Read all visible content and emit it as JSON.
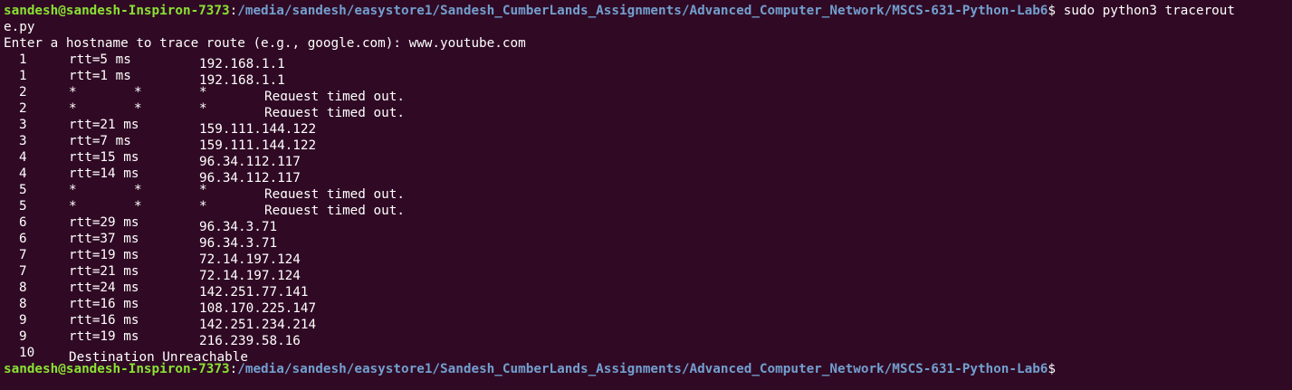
{
  "prompt": {
    "user_host": "sandesh@sandesh-Inspiron-7373",
    "path": "/media/sandesh/easystore1/Sandesh_CumberLands_Assignments/Advanced_Computer_Network/MSCS-631-Python-Lab6",
    "symbol": "$"
  },
  "command": {
    "first_line": " sudo python3 tracerout",
    "wrap_line": "e.py"
  },
  "input_prompt": "Enter a hostname to trace route (e.g., google.com): www.youtube.com",
  "rows": [
    {
      "hop": "1",
      "type": "ok",
      "rtt": "rtt=5 ms",
      "ip": "192.168.1.1"
    },
    {
      "hop": "1",
      "type": "ok",
      "rtt": "rtt=1 ms",
      "ip": "192.168.1.1"
    },
    {
      "hop": "2",
      "type": "timeout",
      "s1": "*",
      "s2": "*",
      "s3": "*",
      "msg": "Request timed out."
    },
    {
      "hop": "2",
      "type": "timeout",
      "s1": "*",
      "s2": "*",
      "s3": "*",
      "msg": "Request timed out."
    },
    {
      "hop": "3",
      "type": "ok",
      "rtt": "rtt=21 ms",
      "ip": "159.111.144.122"
    },
    {
      "hop": "3",
      "type": "ok",
      "rtt": "rtt=7 ms",
      "ip": "159.111.144.122"
    },
    {
      "hop": "4",
      "type": "ok",
      "rtt": "rtt=15 ms",
      "ip": "96.34.112.117"
    },
    {
      "hop": "4",
      "type": "ok",
      "rtt": "rtt=14 ms",
      "ip": "96.34.112.117"
    },
    {
      "hop": "5",
      "type": "timeout",
      "s1": "*",
      "s2": "*",
      "s3": "*",
      "msg": "Request timed out."
    },
    {
      "hop": "5",
      "type": "timeout",
      "s1": "*",
      "s2": "*",
      "s3": "*",
      "msg": "Request timed out."
    },
    {
      "hop": "6",
      "type": "ok",
      "rtt": "rtt=29 ms",
      "ip": "96.34.3.71"
    },
    {
      "hop": "6",
      "type": "ok",
      "rtt": "rtt=37 ms",
      "ip": "96.34.3.71"
    },
    {
      "hop": "7",
      "type": "ok",
      "rtt": "rtt=19 ms",
      "ip": "72.14.197.124"
    },
    {
      "hop": "7",
      "type": "ok",
      "rtt": "rtt=21 ms",
      "ip": "72.14.197.124"
    },
    {
      "hop": "8",
      "type": "ok",
      "rtt": "rtt=24 ms",
      "ip": "142.251.77.141"
    },
    {
      "hop": "8",
      "type": "ok",
      "rtt": "rtt=16 ms",
      "ip": "108.170.225.147"
    },
    {
      "hop": "9",
      "type": "ok",
      "rtt": "rtt=16 ms",
      "ip": "142.251.234.214"
    },
    {
      "hop": "9",
      "type": "ok",
      "rtt": "rtt=19 ms",
      "ip": "216.239.58.16"
    },
    {
      "hop": "10",
      "type": "final",
      "msg": "Destination Unreachable"
    }
  ],
  "final_prompt": {
    "user_host": "sandesh@sandesh-Inspiron-7373",
    "path": "/media/sandesh/easystore1/Sandesh_CumberLands_Assignments/Advanced_Computer_Network/MSCS-631-Python-Lab6",
    "symbol": "$"
  },
  "colors": {
    "background": "#300a24",
    "text": "#ffffff",
    "user_host": "#8ae234",
    "path": "#729fcf"
  }
}
